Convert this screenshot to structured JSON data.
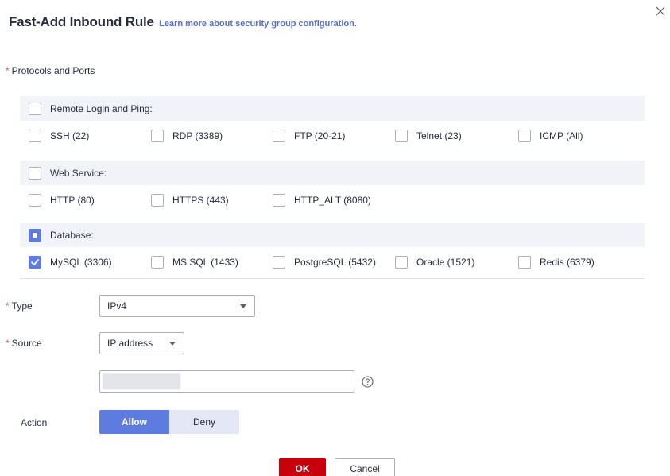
{
  "dialog": {
    "title": "Fast-Add Inbound Rule",
    "learn_link": "Learn more about security group configuration."
  },
  "protocols": {
    "required_mark": "*",
    "label": "Protocols and Ports",
    "groups": [
      {
        "label": "Remote Login and Ping:",
        "state": "unchecked",
        "options": [
          {
            "label": "SSH (22)",
            "checked": false
          },
          {
            "label": "RDP (3389)",
            "checked": false
          },
          {
            "label": "FTP (20-21)",
            "checked": false
          },
          {
            "label": "Telnet (23)",
            "checked": false
          },
          {
            "label": "ICMP (All)",
            "checked": false
          }
        ]
      },
      {
        "label": "Web Service:",
        "state": "unchecked",
        "options": [
          {
            "label": "HTTP (80)",
            "checked": false
          },
          {
            "label": "HTTPS (443)",
            "checked": false
          },
          {
            "label": "HTTP_ALT (8080)",
            "checked": false
          }
        ]
      },
      {
        "label": "Database:",
        "state": "indeterminate",
        "options": [
          {
            "label": "MySQL (3306)",
            "checked": true
          },
          {
            "label": "MS SQL (1433)",
            "checked": false
          },
          {
            "label": "PostgreSQL (5432)",
            "checked": false
          },
          {
            "label": "Oracle (1521)",
            "checked": false
          },
          {
            "label": "Redis (6379)",
            "checked": false
          }
        ]
      }
    ]
  },
  "type_field": {
    "required_mark": "*",
    "label": "Type",
    "value": "IPv4"
  },
  "source_field": {
    "required_mark": "*",
    "label": "Source",
    "value": "IP address"
  },
  "action_field": {
    "label": "Action",
    "allow": "Allow",
    "deny": "Deny",
    "selected": "Allow"
  },
  "footer": {
    "ok": "OK",
    "cancel": "Cancel"
  },
  "colors": {
    "primary": "#5e7ce0",
    "danger": "#c7000b",
    "required": "#e6544e",
    "link": "#526ecc"
  },
  "icons": {
    "close": "close-icon",
    "help": "help-circle-icon",
    "caret": "chevron-down-icon",
    "check": "checkmark-icon"
  }
}
